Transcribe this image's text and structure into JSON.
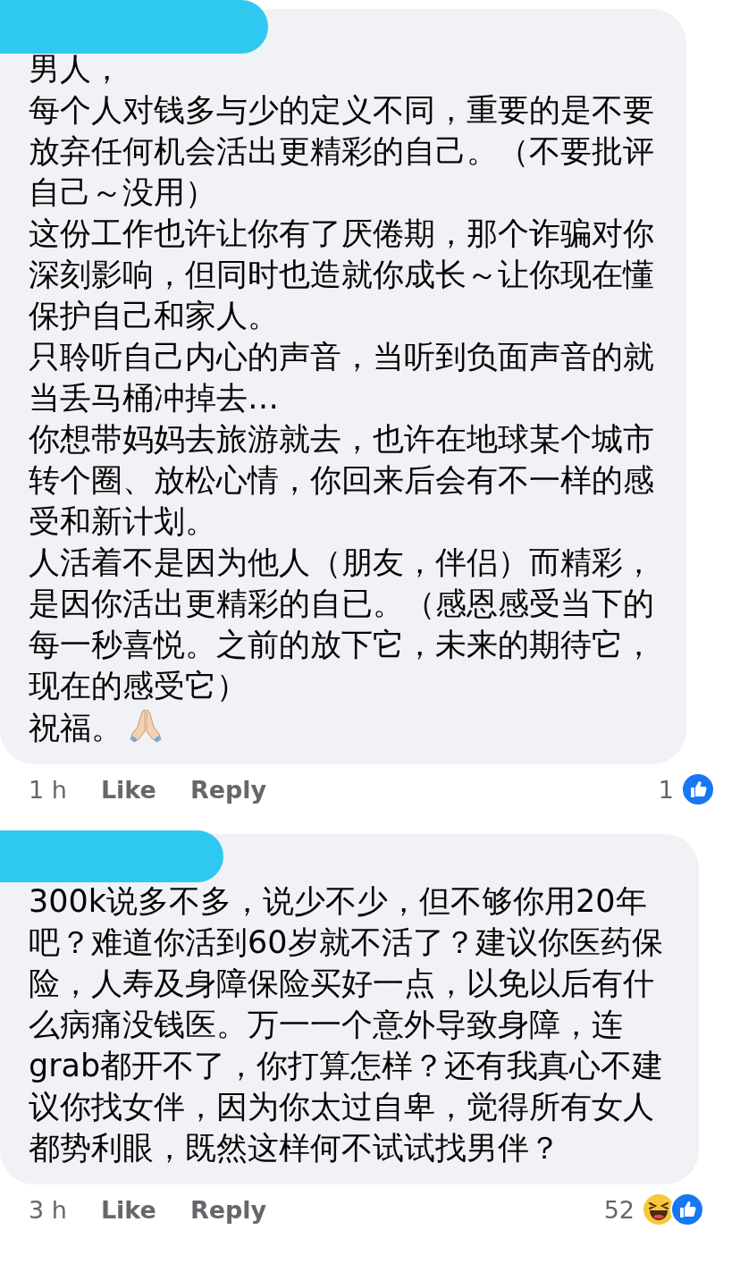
{
  "comments": [
    {
      "paragraphs": [
        "男人，",
        "每个人对钱多与少的定义不同，重要的是不要放弃任何机会活出更精彩的自己。（不要批评自己～没用）",
        "这份工作也许让你有了厌倦期，那个诈骗对你深刻影响，但同时也造就你成长～让你现在懂保护自己和家人。",
        "只聆听自己内心的声音，当听到负面声音的就当丢马桶冲掉去…",
        "你想带妈妈去旅游就去，也许在地球某个城市转个圈、放松心情，你回来后会有不一样的感受和新计划。",
        "人活着不是因为他人（朋友，伴侣）而精彩，是因你活出更精彩的自已。（感恩感受当下的每一秒喜悦。之前的放下它，未来的期待它，现在的感受它）"
      ],
      "sign_off": {
        "text": "祝福。",
        "kind": "praying_hands"
      },
      "time": "1 h",
      "actions": [
        "Like",
        "Reply"
      ],
      "reaction_count": "1",
      "reactions": [
        {
          "kind": "like"
        }
      ]
    },
    {
      "paragraphs": [
        "300k说多不多，说少不少，但不够你用20年吧？难道你活到60岁就不活了？建议你医药保险，人寿及身障保险买好一点，以免以后有什么病痛没钱医。万一一个意外导致身障，连grab都开不了，你打算怎样？还有我真心不建议你找女伴，因为你太过自卑，觉得所有女人都势利眼，既然这样何不试试找男伴？"
      ],
      "time": "3 h",
      "actions": [
        "Like",
        "Reply"
      ],
      "reaction_count": "52",
      "reactions": [
        {
          "kind": "haha"
        },
        {
          "kind": "like"
        }
      ]
    }
  ]
}
